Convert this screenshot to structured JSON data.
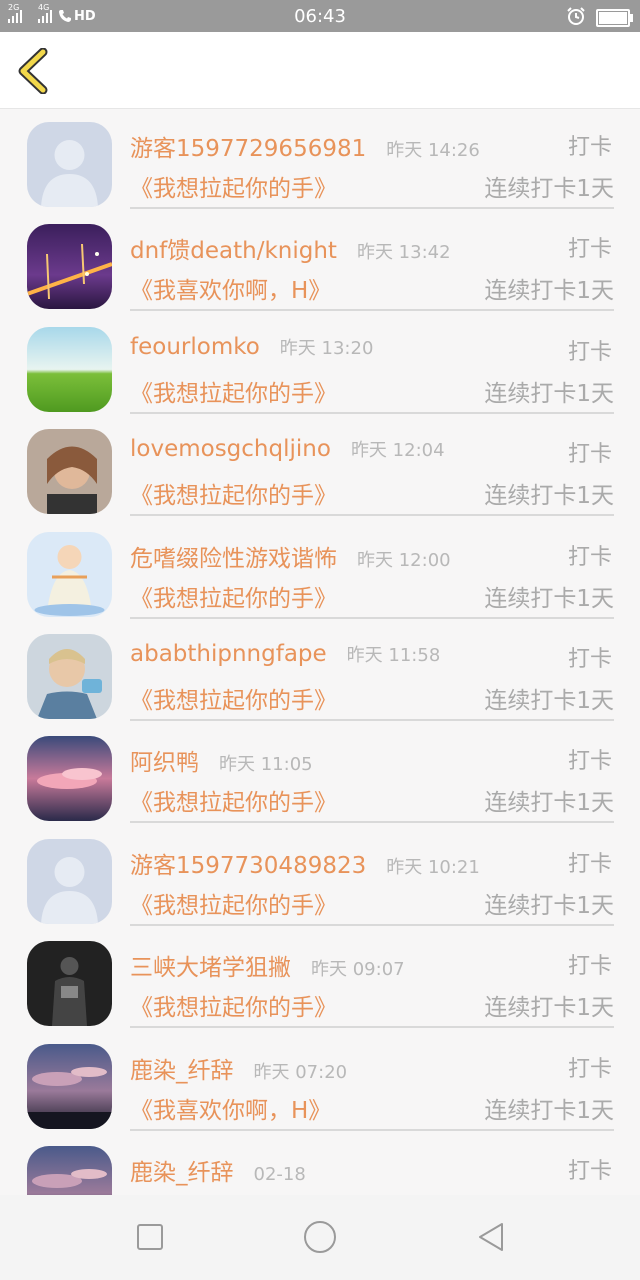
{
  "status_bar": {
    "time": "06:43",
    "sim1_label": "2G",
    "sim2_label": "4G",
    "hd_label": "HD",
    "icons": [
      "signal-icon",
      "signal-icon",
      "call-hd-icon",
      "alarm-icon",
      "battery-icon"
    ]
  },
  "header": {
    "back_icon": "chevron-left-icon",
    "accent_color": "#f2d84b"
  },
  "colors": {
    "name": "#e8935a",
    "meta": "#b8b8b8",
    "divider": "#d9d9d9"
  },
  "entries": [
    {
      "name": "游客1597729656981",
      "time": "昨天 14:26",
      "action": "打卡",
      "song": "《我想拉起你的手》",
      "streak": "连续打卡1天",
      "avatar": "default-avatar"
    },
    {
      "name": "dnf馈death/knight",
      "time": "昨天 13:42",
      "action": "打卡",
      "song": "《我喜欢你啊，H》",
      "streak": "连续打卡1天",
      "avatar": "bridge-night-avatar"
    },
    {
      "name": "feourlomko",
      "time": "昨天 13:20",
      "action": "打卡",
      "song": "《我想拉起你的手》",
      "streak": "连续打卡1天",
      "avatar": "green-field-avatar"
    },
    {
      "name": "lovemosgchqljino",
      "time": "昨天 12:04",
      "action": "打卡",
      "song": "《我想拉起你的手》",
      "streak": "连续打卡1天",
      "avatar": "woman-portrait-avatar"
    },
    {
      "name": "危嗜缀险性游戏谐怖",
      "time": "昨天 12:00",
      "action": "打卡",
      "song": "《我想拉起你的手》",
      "streak": "连续打卡1天",
      "avatar": "guanyin-avatar"
    },
    {
      "name": "ababthipnngfape",
      "time": "昨天 11:58",
      "action": "打卡",
      "song": "《我想拉起你的手》",
      "streak": "连续打卡1天",
      "avatar": "man-portrait-avatar"
    },
    {
      "name": "阿织鸭",
      "time": "昨天 11:05",
      "action": "打卡",
      "song": "《我想拉起你的手》",
      "streak": "连续打卡1天",
      "avatar": "pink-clouds-avatar"
    },
    {
      "name": "游客1597730489823",
      "time": "昨天 10:21",
      "action": "打卡",
      "song": "《我想拉起你的手》",
      "streak": "连续打卡1天",
      "avatar": "default-avatar"
    },
    {
      "name": "三峡大堵学狙撇",
      "time": "昨天 09:07",
      "action": "打卡",
      "song": "《我想拉起你的手》",
      "streak": "连续打卡1天",
      "avatar": "dark-figure-avatar"
    },
    {
      "name": "鹿染_纤辞",
      "time": "昨天 07:20",
      "action": "打卡",
      "song": "《我喜欢你啊，H》",
      "streak": "连续打卡1天",
      "avatar": "dusk-clouds-avatar"
    },
    {
      "name": "鹿染_纤辞",
      "time": "02-18",
      "action": "打卡",
      "song": "",
      "streak": "",
      "avatar": "dusk-clouds-avatar"
    }
  ],
  "bottom_nav": {
    "icons": [
      "recent-apps-icon",
      "home-icon",
      "back-icon"
    ]
  }
}
